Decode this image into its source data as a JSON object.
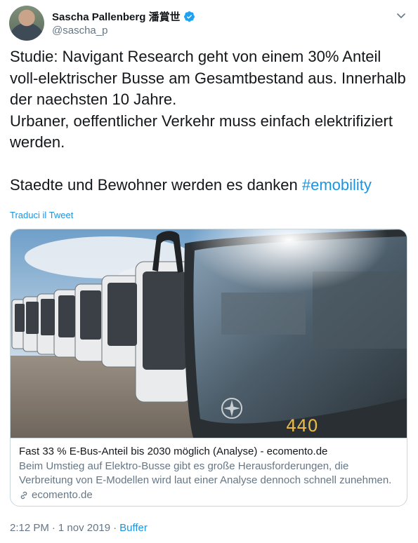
{
  "author": {
    "name": "Sascha Pallenberg 潘賞世",
    "handle": "@sascha_p"
  },
  "tweet": {
    "text": "Studie: Navigant Research geht von einem 30% Anteil voll-elektrischer Busse am Gesamtbestand aus. Innerhalb der naechsten 10 Jahre.\nUrbaner, oeffentlicher Verkehr muss einfach elektrifiziert werden.\n\nStaedte und Bewohner werden es danken ",
    "hashtag": "#emobility",
    "translate_label": "Traduci il Tweet"
  },
  "card": {
    "title": "Fast 33 % E-Bus-Anteil bis 2030 möglich (Analyse) - ecomento.de",
    "description": "Beim Umstieg auf Elektro-Busse gibt es große Herausforderungen, die Verbreitung von E-Modellen wird laut einer Analyse dennoch schnell zunehmen.",
    "domain": "ecomento.de",
    "bus_number": "440"
  },
  "meta": {
    "time": "2:12 PM",
    "separator1": "·",
    "date": "1 nov 2019",
    "separator2": "·",
    "app": "Buffer"
  },
  "colors": {
    "accent": "#1b95e0",
    "verified": "#1da1f2",
    "secondary_text": "#657786",
    "border": "#ccd6dd"
  },
  "icons": [
    "verified-badge-icon",
    "chevron-down-icon",
    "link-icon"
  ]
}
